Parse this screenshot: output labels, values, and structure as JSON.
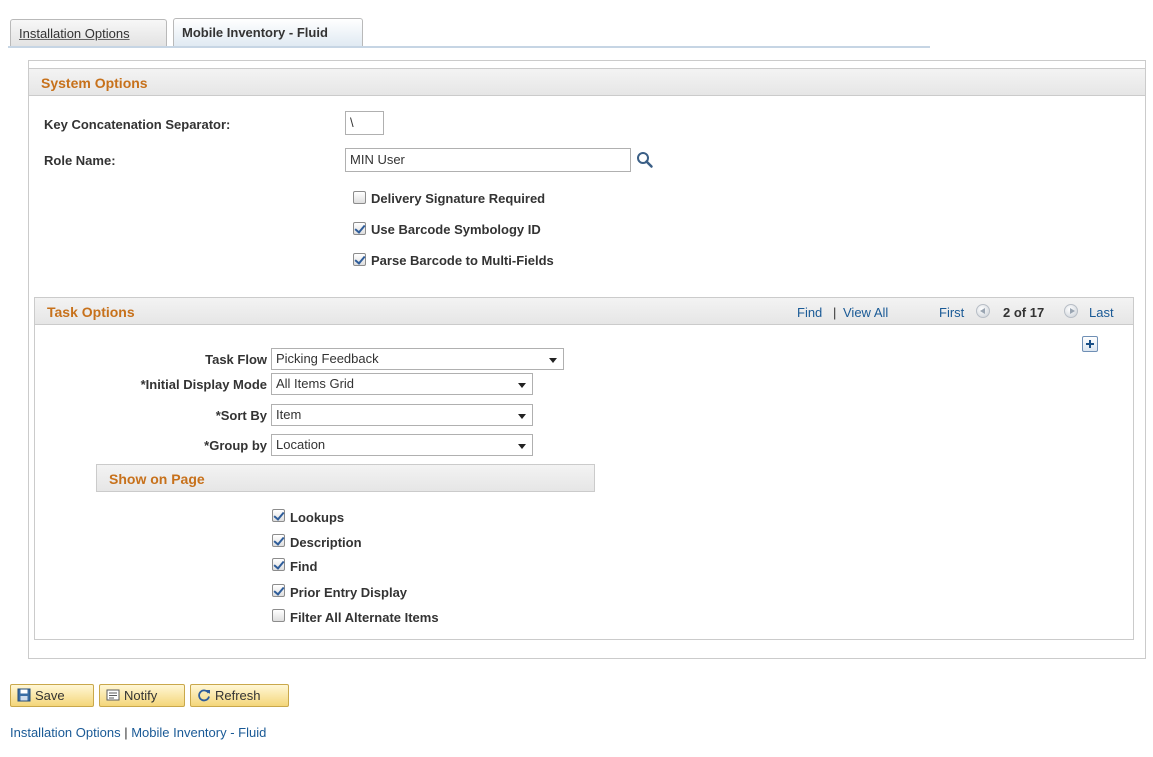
{
  "tabs": [
    {
      "label": "Installation Options",
      "active": false
    },
    {
      "label": "Mobile Inventory - Fluid",
      "active": true
    }
  ],
  "system_options": {
    "header": "System Options",
    "key_separator_label": "Key Concatenation Separator:",
    "key_separator_value": "\\",
    "role_name_label": "Role Name:",
    "role_name_value": "MIN User",
    "checkboxes": [
      {
        "label": "Delivery Signature Required",
        "checked": false
      },
      {
        "label": "Use Barcode Symbology ID",
        "checked": true
      },
      {
        "label": "Parse Barcode to Multi-Fields",
        "checked": true
      }
    ]
  },
  "task_options": {
    "header": "Task Options",
    "find": "Find",
    "separator": "|",
    "view_all": "View All",
    "first": "First",
    "counter": "2 of 17",
    "last": "Last",
    "fields": [
      {
        "label": "Task Flow",
        "value": "Picking Feedback"
      },
      {
        "label": "*Initial Display Mode",
        "value": "All Items Grid"
      },
      {
        "label": "*Sort By",
        "value": "Item"
      },
      {
        "label": "*Group by",
        "value": "Location"
      }
    ],
    "show_on_page": {
      "header": "Show on Page",
      "checkboxes": [
        {
          "label": "Lookups",
          "checked": true
        },
        {
          "label": "Description",
          "checked": true
        },
        {
          "label": "Find",
          "checked": true
        },
        {
          "label": "Prior Entry Display",
          "checked": true
        },
        {
          "label": "Filter All Alternate Items",
          "checked": false
        }
      ]
    }
  },
  "buttons": {
    "save": "Save",
    "notify": "Notify",
    "refresh": "Refresh"
  },
  "footer_links": {
    "installation_options": "Installation Options",
    "separator": "|",
    "mobile_inventory": "Mobile Inventory - Fluid"
  },
  "colors": {
    "section_header": "#c7711b",
    "link": "#1a5a96",
    "button_bg": "#f4d67a"
  }
}
